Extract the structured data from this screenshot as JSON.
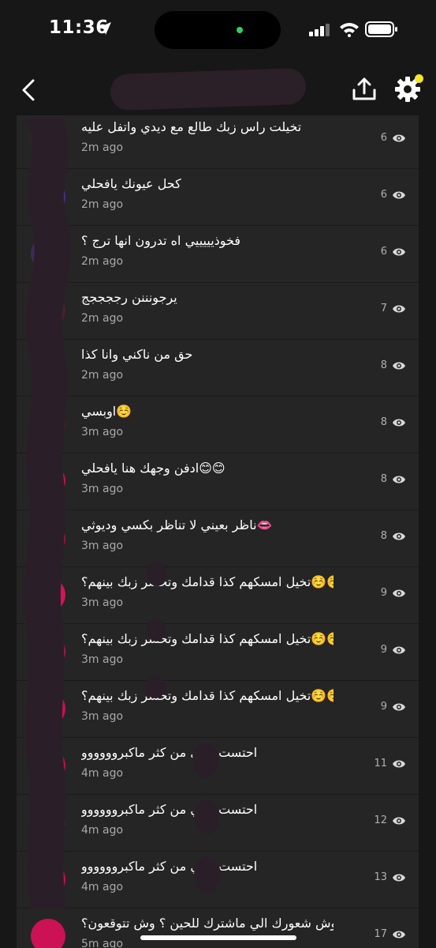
{
  "status_bar": {
    "time": "11:36"
  },
  "rows": [
    {
      "text": "تخيلت راس زبك طالع مع ديدي واتفل عليه",
      "age": "2m ago",
      "views": "6",
      "avatar": "#3a2036"
    },
    {
      "text": "كحل عيونك يافحلي",
      "age": "2m ago",
      "views": "6",
      "avatar": "#4b2a8e"
    },
    {
      "text": "فخوذيييييي اه تدرون انها ترج ؟",
      "age": "2m ago",
      "views": "6",
      "avatar": "#3d2a5c"
    },
    {
      "text": "يرجونننن رججججج",
      "age": "2m ago",
      "views": "7",
      "avatar": "#4a1f2c"
    },
    {
      "text": "حق من ناكني وانا كذا",
      "age": "2m ago",
      "views": "8",
      "avatar": "#3a1030"
    },
    {
      "text": "اوبسي☺️",
      "age": "3m ago",
      "views": "8",
      "avatar": "#6a1428"
    },
    {
      "text": "ادفن وجهك هنا يافحلي😊😊",
      "age": "3m ago",
      "views": "8",
      "avatar": "#c8124a"
    },
    {
      "text": "ناظر بعيني لا تناظر بكسي وديوثي👄",
      "age": "3m ago",
      "views": "8",
      "avatar": "#b80f44"
    },
    {
      "text": "تخيل امسكهم كذا قدامك وتحشر زبك بينهم؟☺️☺️",
      "age": "3m ago",
      "views": "9",
      "avatar": "#d0145a"
    },
    {
      "text": "تخيل امسكهم كذا قدامك وتحشر زبك بينهم؟☺️☺️",
      "age": "3m ago",
      "views": "9",
      "avatar": "#d6125c"
    },
    {
      "text": "تخيل امسكهم كذا قدامك وتحشر زبك بينهم؟☺️☺️",
      "age": "3m ago",
      "views": "9",
      "avatar": "#cc1058"
    },
    {
      "text": "احتست بديي من كثر ماكبروووووو",
      "age": "4m ago",
      "views": "11",
      "avatar": "#c80e50"
    },
    {
      "text": "احتست بديي من كثر ماكبروووووو",
      "age": "4m ago",
      "views": "12",
      "avatar": "#c20f4e"
    },
    {
      "text": "احتست بديي من كثر ماكبروووووو",
      "age": "4m ago",
      "views": "13",
      "avatar": "#c60e52"
    },
    {
      "text": "وش شعورك الي ماشترك للحين ؟ وش تتوقعون؟☺️",
      "age": "5m ago",
      "views": "17",
      "avatar": "#cc1254"
    }
  ],
  "colors": {
    "accent": "#f7e32b",
    "background": "#171717",
    "list_bg": "#252525"
  }
}
